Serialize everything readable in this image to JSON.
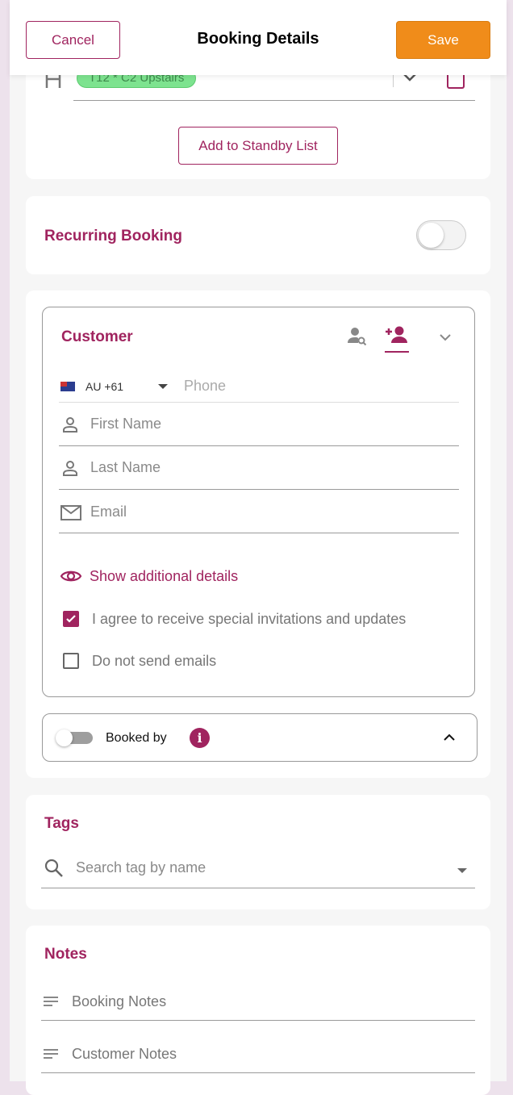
{
  "header": {
    "cancel": "Cancel",
    "title": "Booking Details",
    "save": "Save"
  },
  "table": {
    "chip": "T12 * C2 Upstairs",
    "standby": "Add to Standby List"
  },
  "recurring": {
    "label": "Recurring Booking",
    "enabled": false
  },
  "customer": {
    "title": "Customer",
    "country": "AU +61",
    "phone_placeholder": "Phone",
    "first_placeholder": "First Name",
    "last_placeholder": "Last Name",
    "email_placeholder": "Email",
    "show_more": "Show additional details",
    "opt_in": {
      "label": "I agree to receive special invitations and updates",
      "checked": true
    },
    "no_email": {
      "label": "Do not send emails",
      "checked": false
    }
  },
  "booked_by": {
    "label": "Booked by",
    "enabled": false
  },
  "tags": {
    "title": "Tags",
    "placeholder": "Search tag by name"
  },
  "notes": {
    "title": "Notes",
    "booking_placeholder": "Booking Notes",
    "customer_placeholder": "Customer Notes"
  },
  "colors": {
    "accent": "#a0245f",
    "save": "#f08c1a",
    "chip": "#7de38f"
  }
}
